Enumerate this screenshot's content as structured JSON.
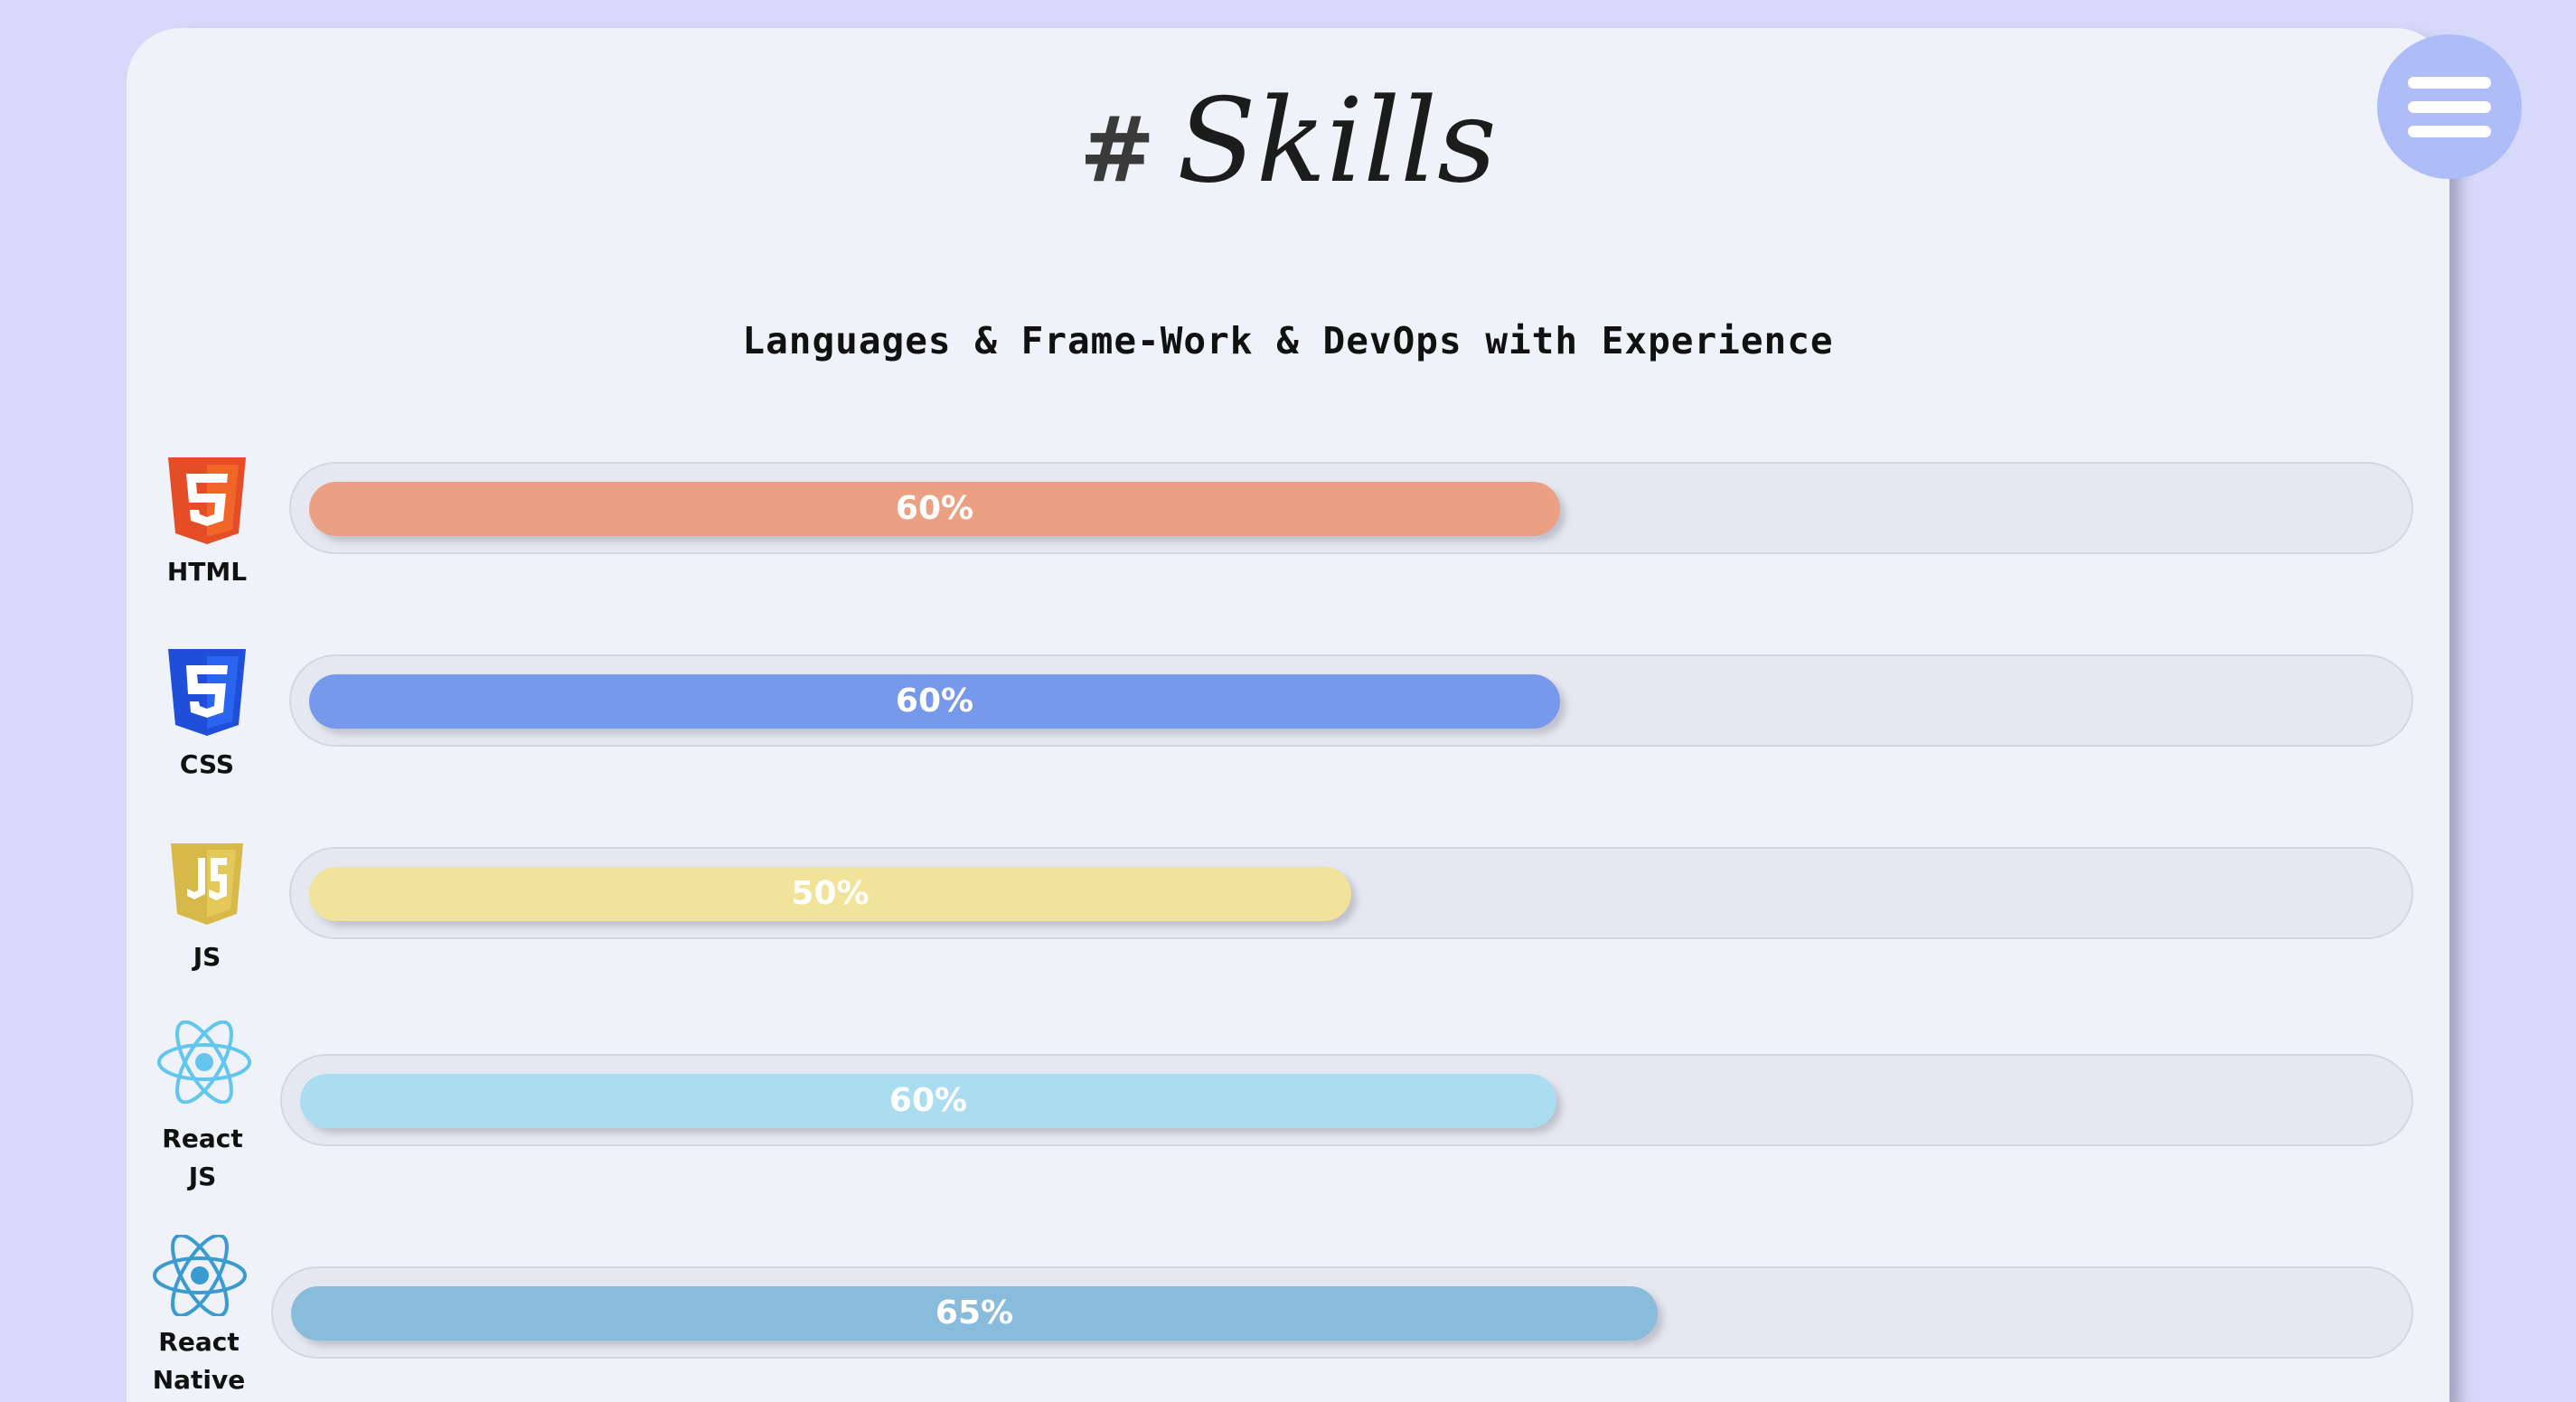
{
  "page": {
    "title_hash": "#",
    "title_text": "Skills",
    "subtitle": "Languages & Frame-Work & DevOps with Experience"
  },
  "skills": [
    {
      "label": "HTML",
      "percent_label": "60%",
      "level": 60,
      "color": "#eca083",
      "icon": "html5-icon"
    },
    {
      "label": "CSS",
      "percent_label": "60%",
      "level": 60,
      "color": "#7799ec",
      "icon": "css3-icon"
    },
    {
      "label": "JS",
      "percent_label": "50%",
      "level": 50,
      "color": "#f1e39a",
      "icon": "js-icon"
    },
    {
      "label": "React JS",
      "percent_label": "60%",
      "level": 60,
      "color": "#abddf1",
      "icon": "react-icon"
    },
    {
      "label": "React Native",
      "percent_label": "65%",
      "level": 65,
      "color": "#88bcda",
      "icon": "react-native-icon"
    }
  ],
  "colors": {
    "background": "#d6d9fa",
    "card": "#eff2f9",
    "menu": "#aebdf7"
  },
  "menu_icon": "hamburger-icon"
}
